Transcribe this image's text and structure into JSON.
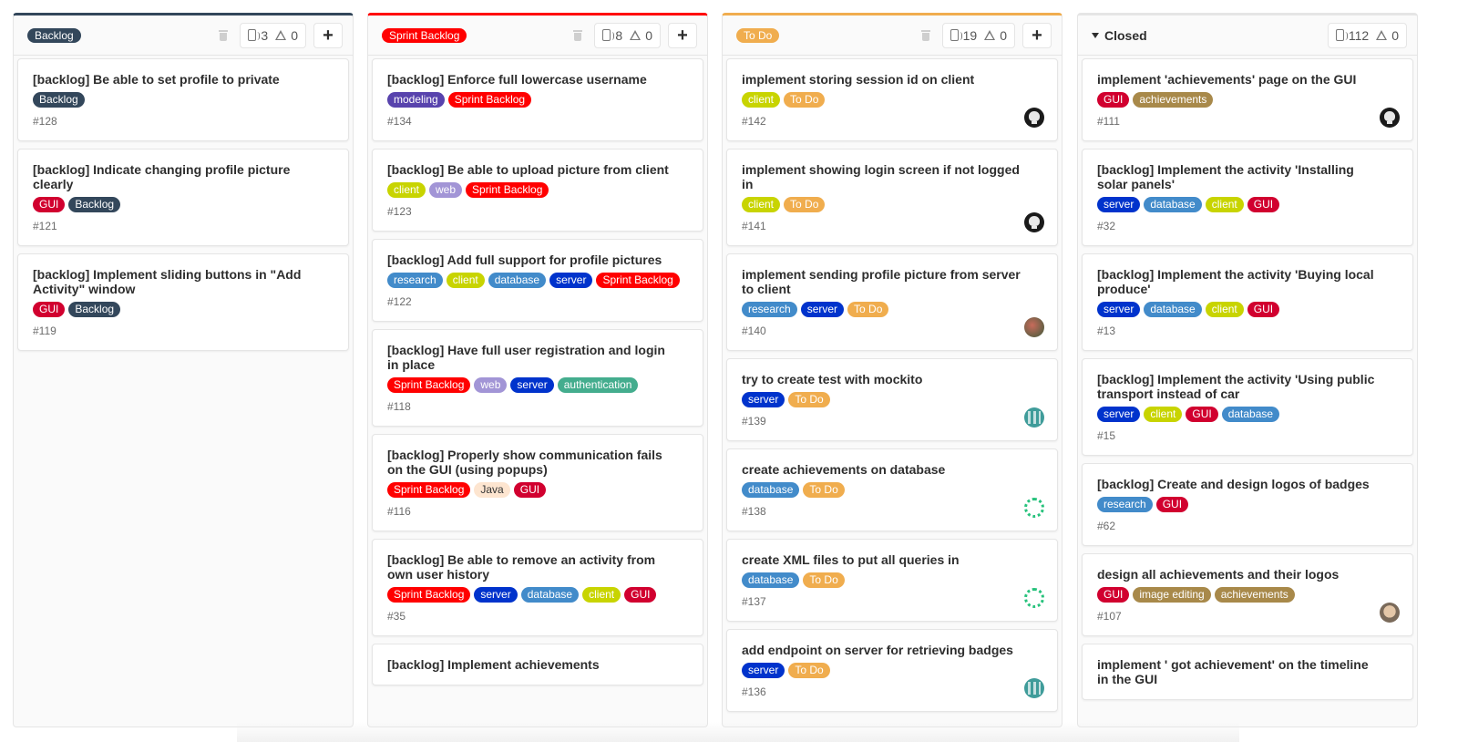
{
  "colors": {
    "backlog": "#33475b",
    "sprint_backlog": "#ff0000",
    "todo": "#f0ad4e",
    "closed": "#33475b",
    "GUI": "#d1002f",
    "client": "#c8d400",
    "web": "#a295d6",
    "research": "#428bca",
    "database": "#428bca",
    "server": "#0033cc",
    "modeling": "#5843ad",
    "authentication": "#44ad8e",
    "Java": "#fde5d0",
    "achievements": "#a8894a",
    "image editing": "#a8894a"
  },
  "lists": [
    {
      "id": "backlog",
      "title": "Backlog",
      "type": "label",
      "color": "#33475b",
      "issue_count": "3",
      "weight": "0",
      "cards": [
        {
          "title": "[backlog] Be able to set profile to private",
          "labels": [
            "Backlog"
          ],
          "number": "#128",
          "avatar": ""
        },
        {
          "title": "[backlog] Indicate changing profile picture clearly",
          "labels": [
            "GUI",
            "Backlog"
          ],
          "number": "#121",
          "avatar": ""
        },
        {
          "title": "[backlog] Implement sliding buttons in \"Add Activity\" window",
          "labels": [
            "GUI",
            "Backlog"
          ],
          "number": "#119",
          "avatar": ""
        }
      ]
    },
    {
      "id": "sprint",
      "title": "Sprint Backlog",
      "type": "label",
      "color": "#ff0000",
      "issue_count": "8",
      "weight": "0",
      "cards": [
        {
          "title": "[backlog] Enforce full lowercase username",
          "labels": [
            "modeling",
            "Sprint Backlog"
          ],
          "number": "#134",
          "avatar": ""
        },
        {
          "title": "[backlog] Be able to upload picture from client",
          "labels": [
            "client",
            "web",
            "Sprint Backlog"
          ],
          "number": "#123",
          "avatar": ""
        },
        {
          "title": "[backlog] Add full support for profile pictures",
          "labels": [
            "research",
            "client",
            "database",
            "server",
            "Sprint Backlog"
          ],
          "number": "#122",
          "avatar": ""
        },
        {
          "title": "[backlog] Have full user registration and login in place",
          "labels": [
            "Sprint Backlog",
            "web",
            "server",
            "authentication"
          ],
          "number": "#118",
          "avatar": ""
        },
        {
          "title": "[backlog] Properly show communication fails on the GUI (using popups)",
          "labels": [
            "Sprint Backlog",
            "Java",
            "GUI"
          ],
          "number": "#116",
          "avatar": ""
        },
        {
          "title": "[backlog] Be able to remove an activity from own user history",
          "labels": [
            "Sprint Backlog",
            "server",
            "database",
            "client",
            "GUI"
          ],
          "number": "#35",
          "avatar": ""
        },
        {
          "title": "[backlog] Implement achievements",
          "labels": [],
          "number": "",
          "avatar": ""
        }
      ]
    },
    {
      "id": "todo",
      "title": "To Do",
      "type": "label",
      "color": "#f0ad4e",
      "issue_count": "19",
      "weight": "0",
      "cards": [
        {
          "title": "implement storing session id on client",
          "labels": [
            "client",
            "To Do"
          ],
          "number": "#142",
          "avatar": "skull"
        },
        {
          "title": "implement showing login screen if not logged in",
          "labels": [
            "client",
            "To Do"
          ],
          "number": "#141",
          "avatar": "skull"
        },
        {
          "title": "implement sending profile picture from server to client",
          "labels": [
            "research",
            "server",
            "To Do"
          ],
          "number": "#140",
          "avatar": "photo"
        },
        {
          "title": "try to create test with mockito",
          "labels": [
            "server",
            "To Do"
          ],
          "number": "#139",
          "avatar": "mosaic"
        },
        {
          "title": "create achievements on database",
          "labels": [
            "database",
            "To Do"
          ],
          "number": "#138",
          "avatar": "ring"
        },
        {
          "title": "create XML files to put all queries in",
          "labels": [
            "database",
            "To Do"
          ],
          "number": "#137",
          "avatar": "ring"
        },
        {
          "title": "add endpoint on server for retrieving badges",
          "labels": [
            "server",
            "To Do"
          ],
          "number": "#136",
          "avatar": "mosaic"
        }
      ]
    },
    {
      "id": "closed",
      "title": "Closed",
      "type": "plain",
      "color": "#33475b",
      "issue_count": "112",
      "weight": "0",
      "cards": [
        {
          "title": "implement 'achievements' page on the GUI",
          "labels": [
            "GUI",
            "achievements"
          ],
          "number": "#111",
          "avatar": "skull"
        },
        {
          "title": "[backlog] Implement the activity 'Installing solar panels'",
          "labels": [
            "server",
            "database",
            "client",
            "GUI"
          ],
          "number": "#32",
          "avatar": ""
        },
        {
          "title": "[backlog] Implement the activity 'Buying local produce'",
          "labels": [
            "server",
            "database",
            "client",
            "GUI"
          ],
          "number": "#13",
          "avatar": ""
        },
        {
          "title": "[backlog] Implement the activity 'Using public transport instead of car",
          "labels": [
            "server",
            "client",
            "GUI",
            "database"
          ],
          "number": "#15",
          "avatar": ""
        },
        {
          "title": "[backlog] Create and design logos of badges",
          "labels": [
            "research",
            "GUI"
          ],
          "number": "#62",
          "avatar": ""
        },
        {
          "title": "design all achievements and their logos",
          "labels": [
            "GUI",
            "image editing",
            "achievements"
          ],
          "number": "#107",
          "avatar": "face"
        },
        {
          "title": "implement ' got achievement' on the timeline in the GUI",
          "labels": [],
          "number": "",
          "avatar": ""
        }
      ]
    }
  ]
}
